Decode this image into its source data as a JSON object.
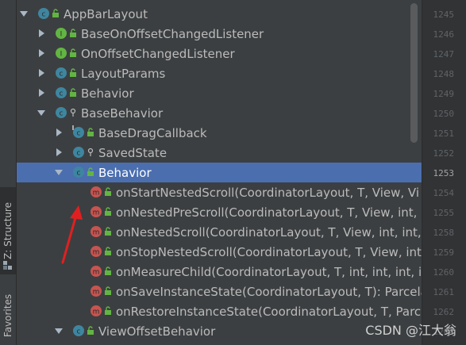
{
  "sidebar": {
    "structure_label": "Z: Structure",
    "favorites_label": "Favorites"
  },
  "tree": {
    "rows": [
      {
        "label": "AppBarLayout",
        "expanded": true,
        "icon": "class-icon",
        "modifier": "public"
      },
      {
        "label": "BaseOnOffsetChangedListener",
        "expanded": false,
        "icon": "interface-icon",
        "modifier": "public"
      },
      {
        "label": "OnOffsetChangedListener",
        "expanded": false,
        "icon": "interface-icon",
        "modifier": "public"
      },
      {
        "label": "LayoutParams",
        "expanded": false,
        "icon": "class-icon",
        "modifier": "public"
      },
      {
        "label": "Behavior",
        "expanded": false,
        "icon": "class-icon",
        "modifier": "public"
      },
      {
        "label": "BaseBehavior",
        "expanded": true,
        "icon": "class-icon",
        "modifier": "package"
      },
      {
        "label": "BaseDragCallback",
        "expanded": false,
        "icon": "abstract-class-icon",
        "modifier": "public"
      },
      {
        "label": "SavedState",
        "expanded": false,
        "icon": "class-icon",
        "modifier": "package"
      },
      {
        "label": "Behavior",
        "expanded": true,
        "icon": "class-icon",
        "modifier": "public",
        "selected": true
      },
      {
        "label": "onStartNestedScroll(CoordinatorLayout, T, View, Vi",
        "icon": "method-icon",
        "modifier": "public"
      },
      {
        "label": "onNestedPreScroll(CoordinatorLayout, T, View, int,",
        "icon": "method-icon",
        "modifier": "public"
      },
      {
        "label": "onNestedScroll(CoordinatorLayout, T, View, int, int,",
        "icon": "method-icon",
        "modifier": "public"
      },
      {
        "label": "onStopNestedScroll(CoordinatorLayout, T, View, int): void",
        "icon": "method-icon",
        "modifier": "public"
      },
      {
        "label": "onMeasureChild(CoordinatorLayout, T, int, int, int, i",
        "icon": "method-icon",
        "modifier": "public"
      },
      {
        "label": "onSaveInstanceState(CoordinatorLayout, T): Parcela",
        "icon": "method-icon",
        "modifier": "public"
      },
      {
        "label": "onRestoreInstanceState(CoordinatorLayout, T, Parc",
        "icon": "method-icon",
        "modifier": "public"
      },
      {
        "label": "ViewOffsetBehavior",
        "expanded": true,
        "icon": "class-icon",
        "modifier": "public"
      }
    ]
  },
  "gutter": {
    "line_numbers": [
      "1245",
      "1246",
      "1247",
      "1248",
      "1249",
      "1250",
      "1251",
      "1252",
      "1253",
      "1254",
      "1255",
      "1258",
      "1259",
      "1260",
      "1261",
      "1262",
      "1264"
    ],
    "current": "1253"
  },
  "watermark": "CSDN @江大翁",
  "colors": {
    "selection": "#4b6eaf",
    "class_icon": "#3e86a0",
    "interface_icon": "#62b543",
    "method_icon": "#c75450",
    "public_lock": "#62b543"
  }
}
